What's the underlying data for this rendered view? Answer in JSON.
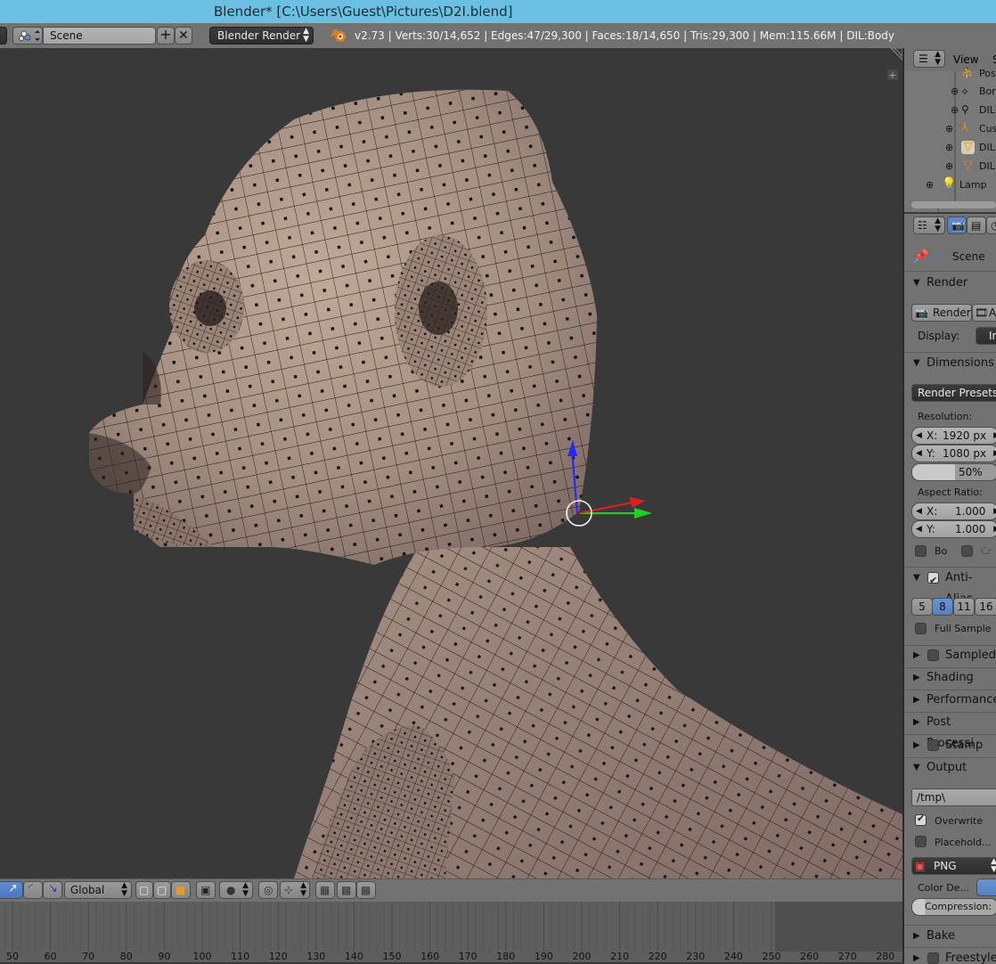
{
  "window": {
    "title": "Blender* [C:\\Users\\Guest\\Pictures\\D2I.blend]"
  },
  "infobar": {
    "scene_name": "Scene",
    "render_engine": "Blender Render",
    "stats": "v2.73 | Verts:30/14,652 | Edges:47/29,300 | Faces:18/14,650 | Tris:29,300 | Mem:115.66M | DIL:Body"
  },
  "viewport_header": {
    "orientation": "Global"
  },
  "timeline": {
    "ticks": [
      "50",
      "60",
      "70",
      "80",
      "90",
      "100",
      "110",
      "120",
      "130",
      "140",
      "150",
      "160",
      "170",
      "180",
      "190",
      "200",
      "210",
      "220",
      "230",
      "240",
      "250",
      "260",
      "270",
      "280"
    ]
  },
  "outliner": {
    "view_menu": "View",
    "items": [
      {
        "label": "Pos",
        "icon": "pose-icon"
      },
      {
        "label": "Bon",
        "icon": "bone-icon"
      },
      {
        "label": "DIL",
        "icon": "armature-icon"
      },
      {
        "label": "Cus",
        "icon": "empty-icon"
      },
      {
        "label": "DIL",
        "icon": "mesh-icon"
      },
      {
        "label": "DIL",
        "icon": "mesh-icon"
      },
      {
        "label": "Lamp",
        "icon": "lamp-icon"
      }
    ]
  },
  "properties": {
    "context_label": "Scene",
    "render_panel": {
      "title": "Render",
      "render_button": "Render",
      "anim_button": "Ani",
      "display_label": "Display:",
      "display_value": "Im"
    },
    "dimensions_panel": {
      "title": "Dimensions",
      "presets": "Render Presets",
      "resolution_label": "Resolution:",
      "res_x_label": "X:",
      "res_x": "1920 px",
      "res_y_label": "Y:",
      "res_y": "1080 px",
      "res_percent": "50%",
      "aspect_label": "Aspect Ratio:",
      "aspect_x_label": "X:",
      "aspect_x": "1.000",
      "aspect_y_label": "Y:",
      "aspect_y": "1.000",
      "border_label": "Bo",
      "crop_label": "Cr"
    },
    "antialias_panel": {
      "title": "Anti-Alias",
      "samples": [
        "5",
        "8",
        "11",
        "16"
      ],
      "selected_sample": "8",
      "full_sample": "Full Sample"
    },
    "collapsed_panels": {
      "sampled": "Sampled",
      "shading": "Shading",
      "performance": "Performance",
      "post_processing": "Post Processi",
      "stamp": "Stamp"
    },
    "output_panel": {
      "title": "Output",
      "path": "/tmp\\",
      "overwrite": "Overwrite",
      "placeholders": "Placehold...",
      "format": "PNG",
      "color_depth_label": "Color De...",
      "compression_label": "Compression:"
    },
    "bake_panel": {
      "title": "Bake"
    },
    "freestyle_panel": {
      "title": "Freestyle"
    }
  },
  "colors": {
    "title_bar": "#6bbfe0",
    "header": "#727272",
    "viewport_bg": "#393939",
    "skin": "#a89284",
    "accent_blue": "#5680c2"
  }
}
